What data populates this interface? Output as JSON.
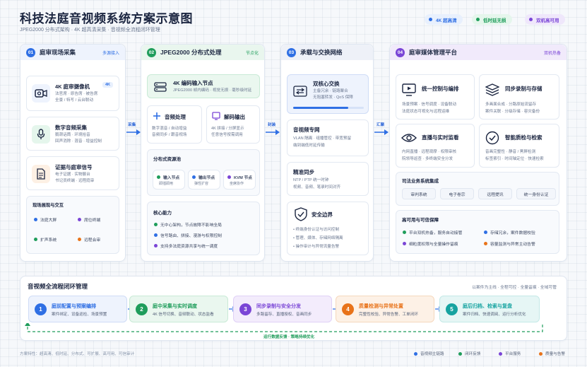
{
  "header": {
    "title": "科技法庭音视频系统方案示意图",
    "subtitle": "JPEG2000 分布式架构 · 4K 超高清采集 · 音视频全流程闭环管理",
    "pills": [
      {
        "label": "4K 超高清",
        "color": "#2f6fe4"
      },
      {
        "label": "低时延无损",
        "color": "#1f9d5b"
      },
      {
        "label": "双机高可用",
        "color": "#7a45d6"
      }
    ]
  },
  "colors": {
    "blue": "#2f6fe4",
    "green": "#1f9d5b",
    "purple": "#7a45d6",
    "orange": "#e8731a",
    "teal": "#15a3a0"
  },
  "panel1": {
    "num": "01",
    "title": "庭审现场采集",
    "tag": "多源接入",
    "cards": [
      {
        "title": "4K 庭审摄像机",
        "badge": "4K",
        "text": [
          "法官席 · 原告席 · 被告席",
          "全景 / 特写 / 云台联动"
        ],
        "icon": "camera-icon"
      },
      {
        "title": "数字音频采集",
        "text": [
          "鹅颈话筒 · 环境拾音",
          "回声消除 · 混音 · 增益控制"
        ],
        "icon": "microphone-icon"
      },
      {
        "title": "证据与庭审信号",
        "text": [
          "电子证据 · 实物展台",
          "书记员终端 · 远程庭审"
        ],
        "icon": "document-icon"
      }
    ],
    "interact_title": "现场展现与交互",
    "interact_items": [
      {
        "label": "法庭大屏",
        "color": "#2f6fe4"
      },
      {
        "label": "席位终端",
        "color": "#7a45d6"
      },
      {
        "label": "扩声系统",
        "color": "#1f9d5b"
      },
      {
        "label": "远程会审",
        "color": "#e8731a"
      }
    ]
  },
  "arrow1_label": "采集",
  "panel2": {
    "num": "02",
    "title": "JPEG2000 分布式处理",
    "tag": "节点化",
    "encode_title": "4K 编码输入节点",
    "encode_text": "JPEG2000 帧内编码 · 视觉无损 · 毫秒级时延",
    "audio_title": "音频处理",
    "audio_text": [
      "数字混音 / 自动增益",
      "音频同步 / 跟音视场"
    ],
    "decode_title": "解码输出",
    "decode_text": [
      "4K 拼接 / 分屏显示",
      "任意信号按需调用"
    ],
    "dist_title": "分布式资源池",
    "dist_items": [
      {
        "label": "输入节点",
        "sub": "即插即用",
        "color": "#1f9d5b"
      },
      {
        "label": "输出节点",
        "sub": "弹性扩容",
        "color": "#2f6fe4"
      },
      {
        "label": "KVM 节点",
        "sub": "坐席协作",
        "color": "#7a45d6"
      }
    ],
    "core_title": "核心能力",
    "core_items": [
      {
        "label": "无中心架构，节点故障不影响全局",
        "color": "#1f9d5b"
      },
      {
        "label": "信号路由、拼接、漫游与权限控制",
        "color": "#2f6fe4"
      },
      {
        "label": "支持多法庭资源共享与统一调度",
        "color": "#7a45d6"
      }
    ]
  },
  "arrow2_label": "封装",
  "panel3": {
    "num": "03",
    "title": "承载与交换网络",
    "core_title": "双核心交换",
    "core_text": [
      "主备冗余 · 链路聚合",
      "无阻塞转发 · QoS 保障"
    ],
    "core_progress": 0.78,
    "net_title": "音视频专网",
    "net_text": [
      "VLAN 隔离 · 组播管控 · 带宽预留",
      "端到端低时延传输"
    ],
    "sync_title": "精准同步",
    "sync_text": [
      "NTP / PTP 统一时钟",
      "视频、音频、笔录时间对齐"
    ],
    "sec_title": "安全边界",
    "sec_items": [
      "终端身份认证与访问控制",
      "管理、媒体、存储网络隔离",
      "操作审计与异常流量告警"
    ]
  },
  "arrow3_label": "汇聚",
  "panel4": {
    "num": "04",
    "title": "庭审媒体管理平台",
    "tag": "双机热备",
    "cards": [
      {
        "title": "统一控制与编排",
        "text": [
          "场景预案 · 信号调度 · 设备联动",
          "法庭状态可视化与远程运维"
        ],
        "icon": "monitor-icon"
      },
      {
        "title": "同步录制与存储",
        "text": [
          "多画面合成 · 分路原始流留存",
          "案件关联 · 分级存储 · 容灾备份"
        ],
        "icon": "stack-icon"
      },
      {
        "title": "直播与实时监看",
        "text": [
          "内网直播 · 远程观摩 · 权限审核",
          "院领导巡查 · 多终端安全分发"
        ],
        "icon": "eye-icon"
      },
      {
        "title": "智能质检与检索",
        "text": [
          "音画完整性 · 静音 / 黑屏检测",
          "标签索引 · 时间轴定位 · 快速检索"
        ],
        "icon": "check-icon"
      }
    ],
    "integ_title": "司法业务系统集成",
    "integ_items": [
      "审判系统",
      "电子卷宗",
      "远程提讯",
      "统一身份认证"
    ],
    "ha_title": "高可用与可信保障",
    "ha_items": [
      {
        "label": "平台双机热备，服务自动接管",
        "color": "#1f9d5b"
      },
      {
        "label": "存储冗余，案件数据校验",
        "color": "#2f6fe4"
      },
      {
        "label": "细粒度权限与全量操作留痕",
        "color": "#7a45d6"
      },
      {
        "label": "容量监测与异常主动告警",
        "color": "#e8731a"
      }
    ]
  },
  "flow": {
    "title": "音视频全流程闭环管理",
    "tag": "以案件为主线 · 全程可控 · 全量留痕 · 全域可管",
    "feedback_label": "运行数据反馈 · 策略持续优化",
    "steps": [
      {
        "num": "1",
        "title": "庭前配置与预案编排",
        "text": "案件绑定、设备巡检、场景预置",
        "color": "#2f6fe4"
      },
      {
        "num": "2",
        "title": "庭中采集与实时调度",
        "text": "4K 信号切换、音频联动、状态监看",
        "color": "#1f9d5b"
      },
      {
        "num": "3",
        "title": "同步录制与安全分发",
        "text": "多路留存、直播授权、音画同步",
        "color": "#7a45d6"
      },
      {
        "num": "4",
        "title": "质量检测与异常处置",
        "text": "完整性校验、异常告警、工单闭环",
        "color": "#e8731a"
      },
      {
        "num": "5",
        "title": "庭后归档、检索与复盘",
        "text": "案件归档、快速调阅、运行分析优化",
        "color": "#15a3a0"
      }
    ]
  },
  "footer": {
    "note": "方案特性：超高清、低时延、分布式、可扩展、高可用、可信审计",
    "legend": [
      {
        "label": "音视频主链路",
        "color": "#2f6fe4"
      },
      {
        "label": "闭环反馈",
        "color": "#1f9d5b"
      },
      {
        "label": "平台服务",
        "color": "#7a45d6"
      },
      {
        "label": "质量与告警",
        "color": "#e8731a"
      }
    ]
  }
}
